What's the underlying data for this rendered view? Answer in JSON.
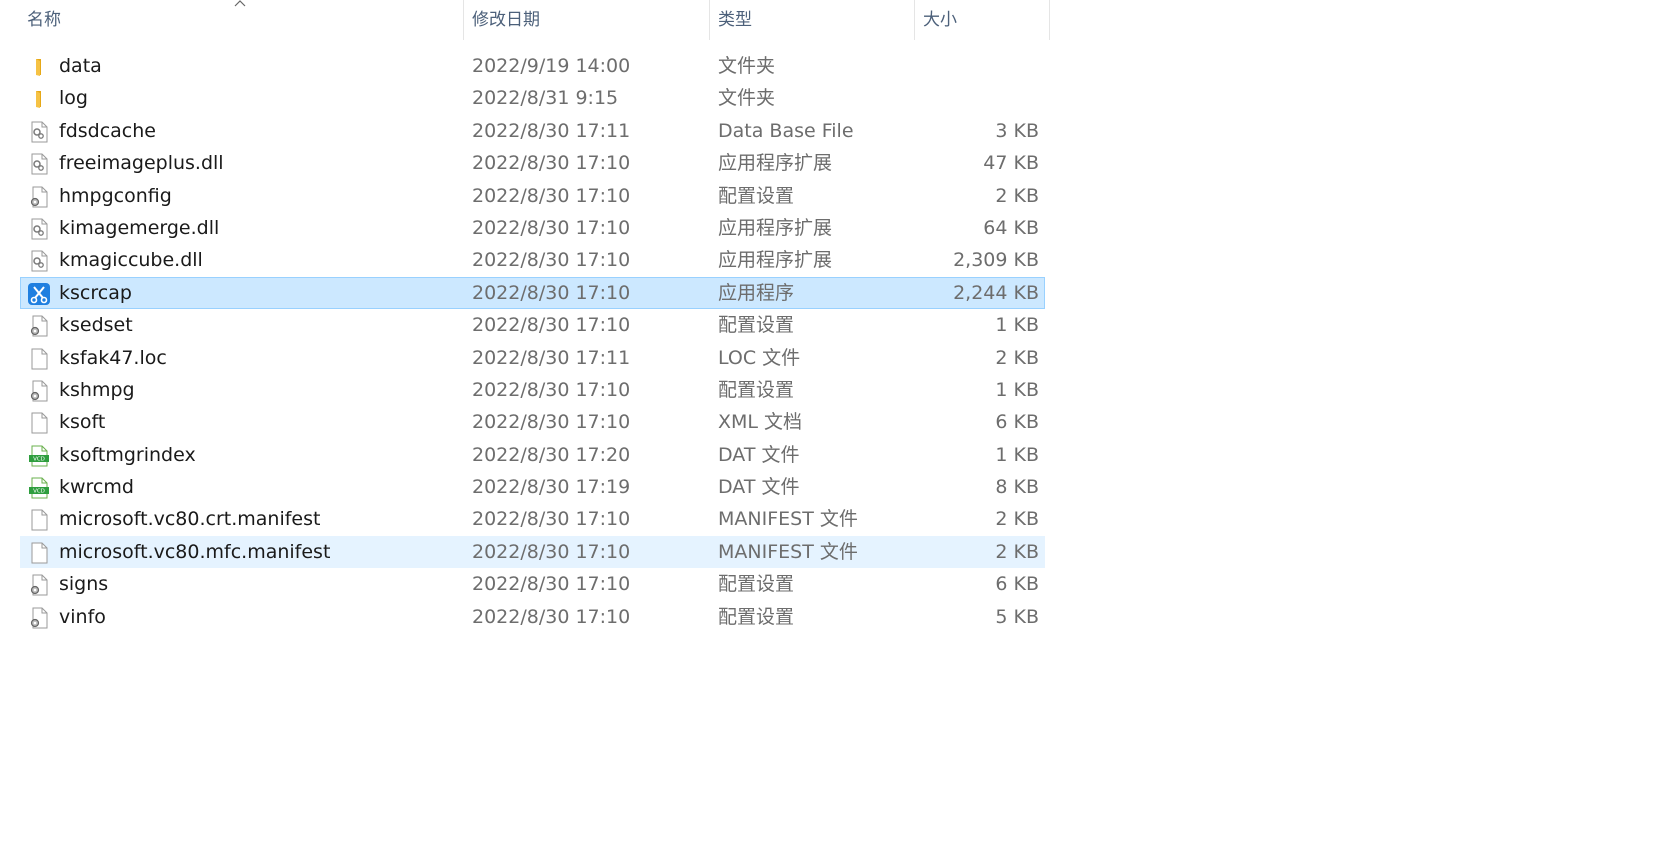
{
  "header": {
    "name": "名称",
    "date": "修改日期",
    "type": "类型",
    "size": "大小"
  },
  "files": [
    {
      "name": "data",
      "date": "2022/9/19 14:00",
      "type": "文件夹",
      "size": "",
      "icon": "folder-icon",
      "state": ""
    },
    {
      "name": "log",
      "date": "2022/8/31 9:15",
      "type": "文件夹",
      "size": "",
      "icon": "folder-icon",
      "state": ""
    },
    {
      "name": "fdsdcache",
      "date": "2022/8/30 17:11",
      "type": "Data Base File",
      "size": "3 KB",
      "icon": "gear-file-icon",
      "state": ""
    },
    {
      "name": "freeimageplus.dll",
      "date": "2022/8/30 17:10",
      "type": "应用程序扩展",
      "size": "47 KB",
      "icon": "gear-file-icon",
      "state": ""
    },
    {
      "name": "hmpgconfig",
      "date": "2022/8/30 17:10",
      "type": "配置设置",
      "size": "2 KB",
      "icon": "config-file-icon",
      "state": ""
    },
    {
      "name": "kimagemerge.dll",
      "date": "2022/8/30 17:10",
      "type": "应用程序扩展",
      "size": "64 KB",
      "icon": "gear-file-icon",
      "state": ""
    },
    {
      "name": "kmagiccube.dll",
      "date": "2022/8/30 17:10",
      "type": "应用程序扩展",
      "size": "2,309 KB",
      "icon": "gear-file-icon",
      "state": ""
    },
    {
      "name": "kscrcap",
      "date": "2022/8/30 17:10",
      "type": "应用程序",
      "size": "2,244 KB",
      "icon": "scissors-app-icon",
      "state": "selected"
    },
    {
      "name": "ksedset",
      "date": "2022/8/30 17:10",
      "type": "配置设置",
      "size": "1 KB",
      "icon": "config-file-icon",
      "state": ""
    },
    {
      "name": "ksfak47.loc",
      "date": "2022/8/30 17:11",
      "type": "LOC 文件",
      "size": "2 KB",
      "icon": "blank-file-icon",
      "state": ""
    },
    {
      "name": "kshmpg",
      "date": "2022/8/30 17:10",
      "type": "配置设置",
      "size": "1 KB",
      "icon": "config-file-icon",
      "state": ""
    },
    {
      "name": "ksoft",
      "date": "2022/8/30 17:10",
      "type": "XML 文档",
      "size": "6 KB",
      "icon": "blank-file-icon",
      "state": ""
    },
    {
      "name": "ksoftmgrindex",
      "date": "2022/8/30 17:20",
      "type": "DAT 文件",
      "size": "1 KB",
      "icon": "vcd-file-icon",
      "state": ""
    },
    {
      "name": "kwrcmd",
      "date": "2022/8/30 17:19",
      "type": "DAT 文件",
      "size": "8 KB",
      "icon": "vcd-file-icon",
      "state": ""
    },
    {
      "name": "microsoft.vc80.crt.manifest",
      "date": "2022/8/30 17:10",
      "type": "MANIFEST 文件",
      "size": "2 KB",
      "icon": "blank-file-icon",
      "state": ""
    },
    {
      "name": "microsoft.vc80.mfc.manifest",
      "date": "2022/8/30 17:10",
      "type": "MANIFEST 文件",
      "size": "2 KB",
      "icon": "blank-file-icon",
      "state": "hover"
    },
    {
      "name": "signs",
      "date": "2022/8/30 17:10",
      "type": "配置设置",
      "size": "6 KB",
      "icon": "config-file-icon",
      "state": ""
    },
    {
      "name": "vinfo",
      "date": "2022/8/30 17:10",
      "type": "配置设置",
      "size": "5 KB",
      "icon": "config-file-icon",
      "state": ""
    }
  ],
  "vcd_label": "VCD",
  "colors": {
    "selected_bg": "#cce8ff",
    "hover_bg": "#e5f3ff",
    "folder": "#f6c244"
  }
}
